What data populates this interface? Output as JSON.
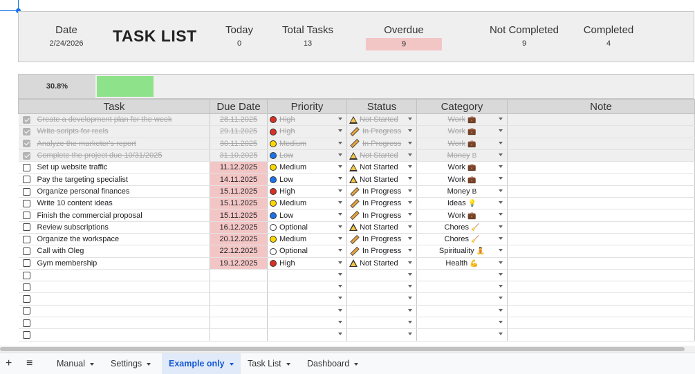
{
  "summary": {
    "title": "TASK LIST",
    "date_label": "Date",
    "date_value": "2/24/2026",
    "today_label": "Today",
    "today_value": "0",
    "total_label": "Total Tasks",
    "total_value": "13",
    "overdue_label": "Overdue",
    "overdue_value": "9",
    "not_completed_label": "Not Completed",
    "not_completed_value": "9",
    "completed_label": "Completed",
    "completed_value": "4"
  },
  "progress": {
    "percent_text": "30.8%",
    "fraction": 0.308
  },
  "columns": {
    "task": "Task",
    "due": "Due Date",
    "priority": "Priority",
    "status": "Status",
    "category": "Category",
    "note": "Note"
  },
  "colors": {
    "high": "#d93025",
    "medium": "#fbd700",
    "low": "#1a73e8",
    "optional": "#ffffff",
    "progress": "#8ee38a",
    "overdue": "#f3c6c6"
  },
  "tasks": [
    {
      "done": true,
      "task": "Create a development plan for the week",
      "due": "28.11.2025",
      "priority": "High",
      "status": "Not Started",
      "category": "Work",
      "cat_icon": "💼"
    },
    {
      "done": true,
      "task": "Write scripts for reels",
      "due": "29.11.2025",
      "priority": "High",
      "status": "In Progress",
      "category": "Work",
      "cat_icon": "💼"
    },
    {
      "done": true,
      "task": "Analyze the marketer's report",
      "due": "30.11.2025",
      "priority": "Medium",
      "status": "In Progress",
      "category": "Work",
      "cat_icon": "💼"
    },
    {
      "done": true,
      "task": "Complete the project due 10/31/2025",
      "due": "31.10.2025",
      "priority": "Low",
      "status": "Not Started",
      "category": "Money",
      "cat_icon": "B"
    },
    {
      "done": false,
      "task": "Set up website traffic",
      "due": "11.12.2025",
      "priority": "Medium",
      "status": "Not Started",
      "category": "Work",
      "cat_icon": "💼"
    },
    {
      "done": false,
      "task": "Pay the targeting specialist",
      "due": "14.11.2025",
      "priority": "Low",
      "status": "Not Started",
      "category": "Work",
      "cat_icon": "💼"
    },
    {
      "done": false,
      "task": "Organize personal finances",
      "due": "15.11.2025",
      "priority": "High",
      "status": "In Progress",
      "category": "Money",
      "cat_icon": "B"
    },
    {
      "done": false,
      "task": "Write 10 content ideas",
      "due": "15.11.2025",
      "priority": "Medium",
      "status": "In Progress",
      "category": "Ideas",
      "cat_icon": "💡"
    },
    {
      "done": false,
      "task": "Finish the commercial proposal",
      "due": "15.11.2025",
      "priority": "Low",
      "status": "In Progress",
      "category": "Work",
      "cat_icon": "💼"
    },
    {
      "done": false,
      "task": "Review subscriptions",
      "due": "16.12.2025",
      "priority": "Optional",
      "status": "Not Started",
      "category": "Chores",
      "cat_icon": "🧹"
    },
    {
      "done": false,
      "task": "Organize the workspace",
      "due": "20.12.2025",
      "priority": "Medium",
      "status": "In Progress",
      "category": "Chores",
      "cat_icon": "🧹"
    },
    {
      "done": false,
      "task": "Call with Oleg",
      "due": "22.12.2025",
      "priority": "Optional",
      "status": "In Progress",
      "category": "Spirituality",
      "cat_icon": "🧘"
    },
    {
      "done": false,
      "task": "Gym membership",
      "due": "19.12.2025",
      "priority": "High",
      "status": "Not Started",
      "category": "Health",
      "cat_icon": "💪"
    }
  ],
  "empty_rows": 6,
  "sheet_tabs": {
    "add_label": "+",
    "list_label": "≡",
    "tabs": [
      {
        "label": "Manual",
        "active": false
      },
      {
        "label": "Settings",
        "active": false
      },
      {
        "label": "Example only",
        "active": true
      },
      {
        "label": "Task List",
        "active": false
      },
      {
        "label": "Dashboard",
        "active": false
      }
    ]
  }
}
